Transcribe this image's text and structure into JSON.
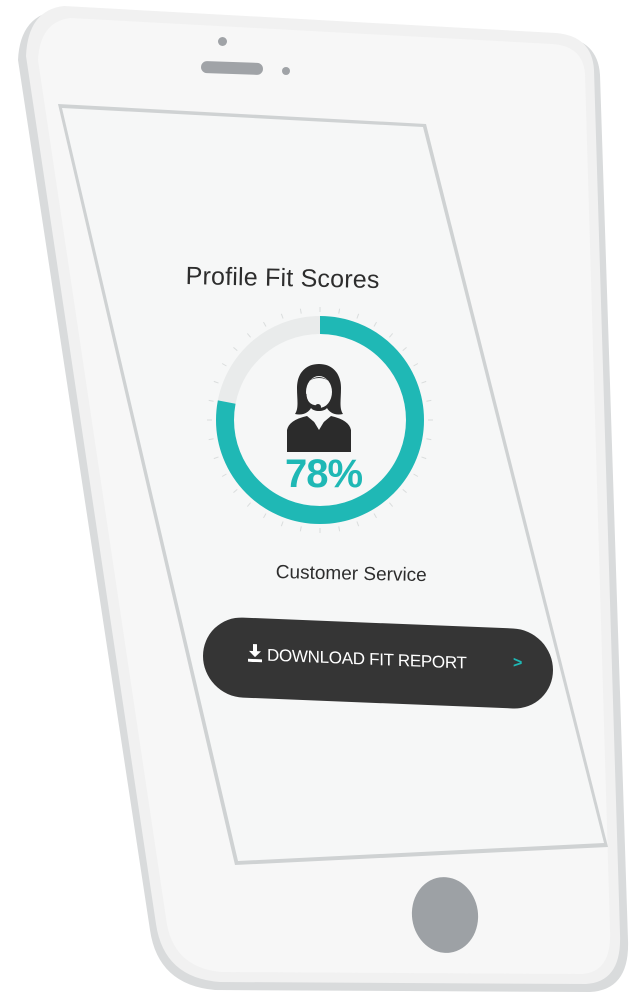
{
  "screen": {
    "title": "Profile Fit Scores",
    "score": {
      "value_text": "78%",
      "value": 78,
      "role": "Customer Service",
      "icon": "customer-service-agent-icon"
    },
    "download": {
      "icon": "download-icon",
      "label": "DOWNLOAD FIT REPORT",
      "chevron": ">"
    }
  },
  "colors": {
    "accent": "#1fb8b5",
    "track": "#e9ebeb",
    "button_bg": "#353535",
    "screen_bg": "#f6f7f7",
    "frame": "#ededed"
  }
}
